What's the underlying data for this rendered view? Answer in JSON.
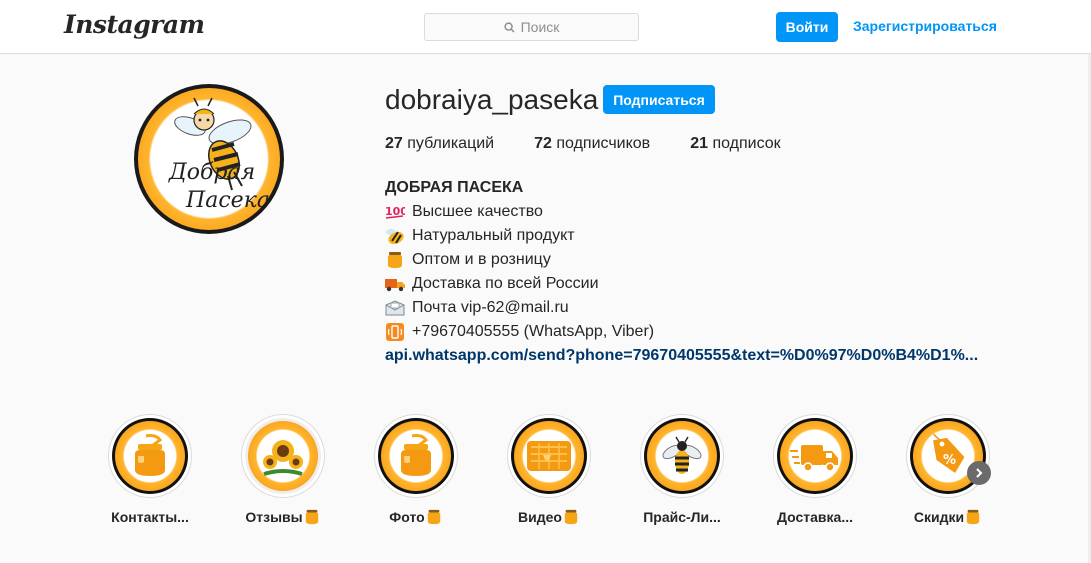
{
  "nav": {
    "logo": "Instagram",
    "search_placeholder": "Поиск",
    "login_label": "Войти",
    "register_label": "Зарегистрироваться"
  },
  "profile": {
    "avatar_text_1": "Добрая",
    "avatar_text_2": "Пасека",
    "username": "dobraiya_paseka",
    "follow_label": "Подписаться",
    "stats": {
      "posts_count": "27",
      "posts_label": "публикаций",
      "followers_count": "72",
      "followers_label": "подписчиков",
      "following_count": "21",
      "following_label": "подписок"
    },
    "bio": {
      "name": "ДОБРАЯ ПАСЕКА",
      "lines": [
        {
          "icon": "hundred-icon",
          "text": "Высшее качество"
        },
        {
          "icon": "bee-icon",
          "text": "Натуральный продукт"
        },
        {
          "icon": "honey-pot-icon",
          "text": "Оптом и в розницу"
        },
        {
          "icon": "truck-icon",
          "text": "Доставка по всей России"
        },
        {
          "icon": "envelope-icon",
          "text": "Почта vip-62@mail.ru"
        },
        {
          "icon": "phone-icon",
          "text": "+79670405555 (WhatsApp, Viber)"
        }
      ],
      "link": "api.whatsapp.com/send?phone=79670405555&text=%D0%97%D0%B4%D1%..."
    }
  },
  "highlights": [
    {
      "label": "Контакты...",
      "icon": "honey-jar-icon",
      "has_pot": false
    },
    {
      "label": "Отзывы",
      "icon": "sunflower-icon",
      "has_pot": true
    },
    {
      "label": "Фото",
      "icon": "honey-jar-icon",
      "has_pot": true
    },
    {
      "label": "Видео",
      "icon": "honeycomb-icon",
      "has_pot": true
    },
    {
      "label": "Прайс-Ли...",
      "icon": "bee-icon",
      "has_pot": false
    },
    {
      "label": "Доставка...",
      "icon": "delivery-truck-icon",
      "has_pot": false
    },
    {
      "label": "Скидки",
      "icon": "discount-tag-icon",
      "has_pot": true
    }
  ],
  "colors": {
    "accent": "#0095f6",
    "link": "#00376b",
    "honey": "#f28a00"
  }
}
